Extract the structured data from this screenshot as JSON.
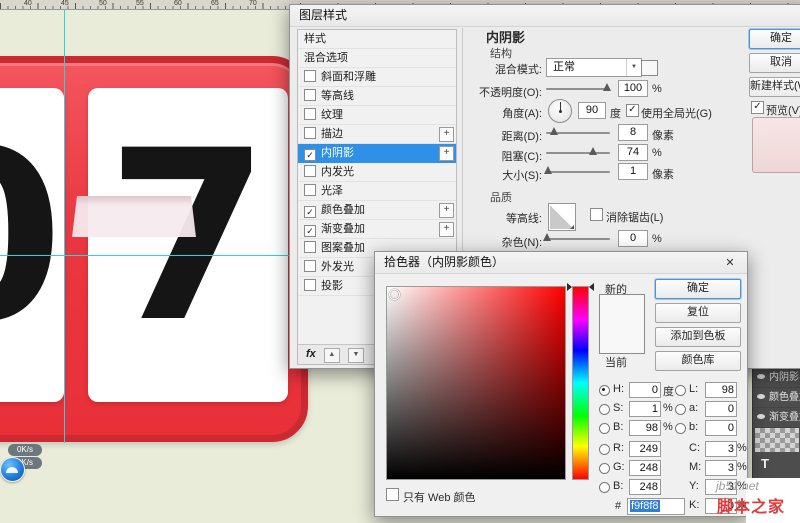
{
  "icons": {
    "check": "✓",
    "plus": "+",
    "close": "✕",
    "dropdown_arrow": "▼",
    "up_arrow": "▲",
    "down_arrow": "▼",
    "fx": "fx"
  },
  "colors": {
    "selection_blue": "#2e90e6",
    "calendar_red": "#ea3740",
    "guide_cyan": "#2bd2e6",
    "picked_color": "#f9f8f8"
  },
  "ruler": {
    "numbers": [
      "40",
      "45",
      "50",
      "55",
      "60",
      "65",
      "70"
    ]
  },
  "canvas": {
    "digit_left": "0",
    "digit_right": "7"
  },
  "speed_overlay": {
    "up_speed": "0K/s",
    "down_speed": "0K/s"
  },
  "layer_style_dialog": {
    "title": "图层样式",
    "styles_header": "样式",
    "blending_options": "混合选项",
    "style_items": [
      {
        "label": "斜面和浮雕",
        "checked": false,
        "plus": false
      },
      {
        "label": "等高线",
        "checked": false,
        "plus": false
      },
      {
        "label": "纹理",
        "checked": false,
        "plus": false
      },
      {
        "label": "描边",
        "checked": false,
        "plus": true
      },
      {
        "label": "内阴影",
        "checked": true,
        "plus": true,
        "selected": true
      },
      {
        "label": "内发光",
        "checked": false,
        "plus": false
      },
      {
        "label": "光泽",
        "checked": false,
        "plus": false
      },
      {
        "label": "颜色叠加",
        "checked": true,
        "plus": true
      },
      {
        "label": "渐变叠加",
        "checked": true,
        "plus": true
      },
      {
        "label": "图案叠加",
        "checked": false,
        "plus": false
      },
      {
        "label": "外发光",
        "checked": false,
        "plus": true
      },
      {
        "label": "投影",
        "checked": false,
        "plus": true
      }
    ],
    "buttons": {
      "ok": "确定",
      "cancel": "取消",
      "new_style": "新建样式(W)...",
      "preview": "预览(V)"
    },
    "inner_shadow": {
      "title": "内阴影",
      "structure_header": "结构",
      "blend_mode_label": "混合模式:",
      "blend_mode_value": "正常",
      "opacity_label": "不透明度(O):",
      "opacity_value": "100",
      "opacity_unit": "%",
      "angle_label": "角度(A):",
      "angle_value": "90",
      "angle_unit": "度",
      "use_global_light": "使用全局光(G)",
      "distance_label": "距离(D):",
      "distance_value": "8",
      "distance_unit": "像素",
      "choke_label": "阻塞(C):",
      "choke_value": "74",
      "choke_unit": "%",
      "size_label": "大小(S):",
      "size_value": "1",
      "size_unit": "像素",
      "quality_header": "品质",
      "contour_label": "等高线:",
      "antialias_label": "消除锯齿(L)",
      "noise_label": "杂色(N):",
      "noise_value": "0",
      "noise_unit": "%"
    }
  },
  "color_picker": {
    "title": "拾色器（内阴影颜色）",
    "new_label": "新的",
    "current_label": "当前",
    "ok": "确定",
    "reset": "复位",
    "add_to_swatches": "添加到色板",
    "color_libraries": "颜色库",
    "hsb": {
      "h_label": "H:",
      "h_value": "0",
      "h_unit": "度",
      "s_label": "S:",
      "s_value": "1",
      "s_unit": "%",
      "b_label": "B:",
      "b_value": "98",
      "b_unit": "%"
    },
    "rgb": {
      "r_label": "R:",
      "r_value": "249",
      "g_label": "G:",
      "g_value": "248",
      "b_label": "B:",
      "b_value": "248"
    },
    "lab": {
      "l_label": "L:",
      "l_value": "98",
      "a_label": "a:",
      "a_value": "0",
      "b_label": "b:",
      "b_value": "0"
    },
    "cmyk": {
      "c_label": "C:",
      "c_value": "3",
      "c_unit": "%",
      "m_label": "M:",
      "m_value": "3",
      "m_unit": "%",
      "y_label": "Y:",
      "y_value": "3",
      "y_unit": "%",
      "k_label": "K:",
      "k_value": "0",
      "k_unit": "%"
    },
    "hex_prefix": "#",
    "hex_value": "f9f8f8",
    "web_only_label": "只有 Web 颜色"
  },
  "layers_panel": {
    "rows": [
      "内阴影",
      "颜色叠加",
      "渐变叠加"
    ],
    "type_icon": "T"
  },
  "watermark": {
    "site": "jb51.net",
    "name": "脚本之家"
  }
}
